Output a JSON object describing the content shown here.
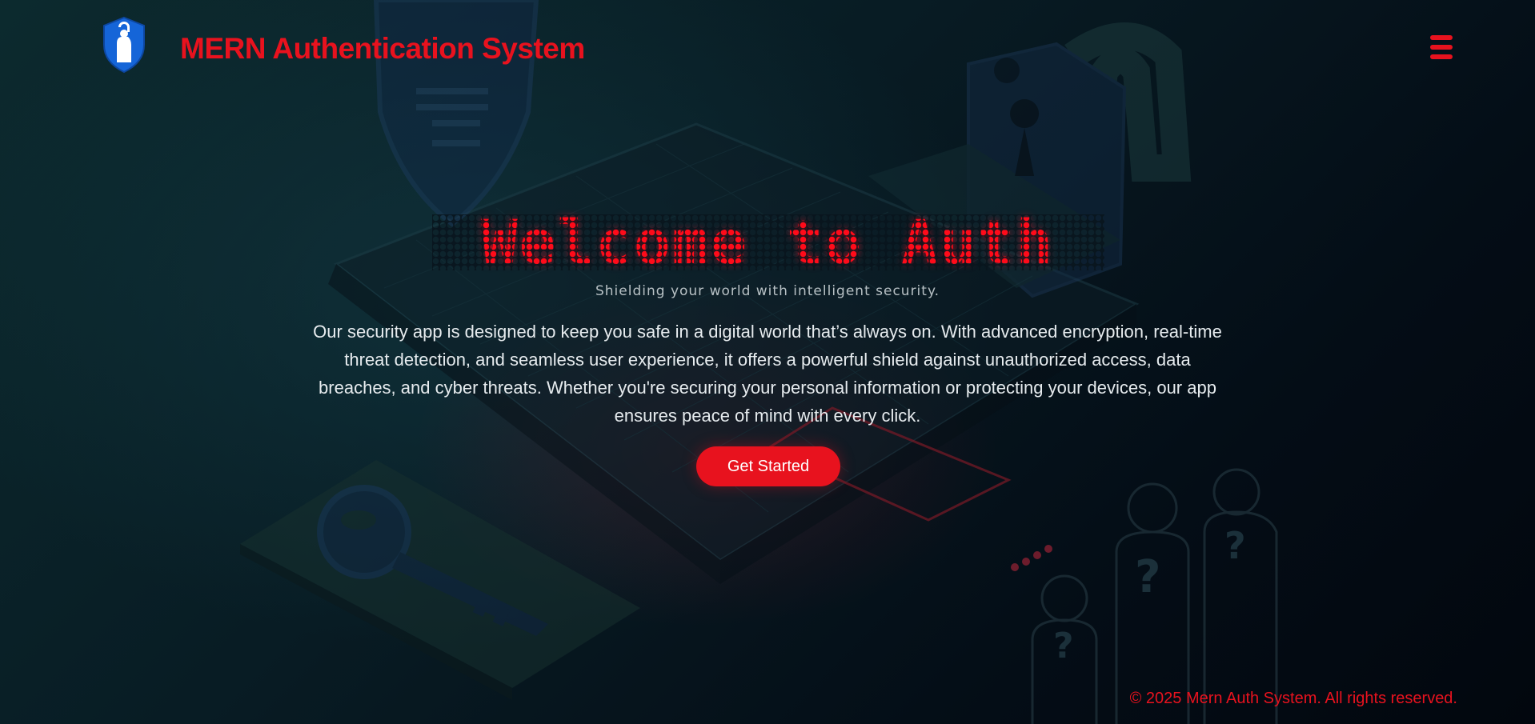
{
  "header": {
    "brand_title": "MERN Authentication System",
    "logo_icon": "shield-lock-person-icon",
    "menu_icon": "hamburger-menu-icon"
  },
  "hero": {
    "title": "Welcome to Auth",
    "subtitle": "Shielding your world with intelligent security.",
    "description": "Our security app is designed to keep you safe in a digital world that’s always on. With advanced encryption, real-time threat detection, and seamless user experience, it offers a powerful shield against unauthorized access, data breaches, and cyber threats. Whether you're securing your personal information or protecting your devices, our app ensures peace of mind with every click.",
    "cta_label": "Get Started"
  },
  "footer": {
    "copyright": "© 2025 Mern Auth System. All rights reserved."
  },
  "colors": {
    "accent": "#e8121e",
    "title_red": "#ff0b1a",
    "background_dark": "#06121a",
    "logo_blue": "#1565d8"
  }
}
